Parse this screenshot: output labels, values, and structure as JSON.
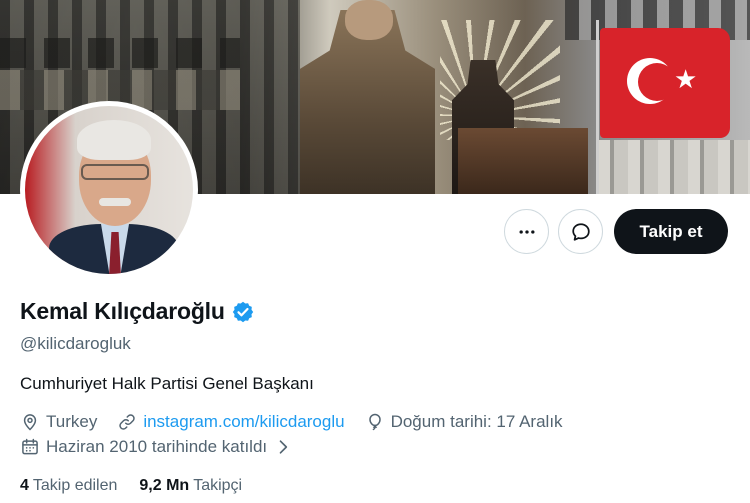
{
  "profile": {
    "name": "Kemal Kılıçdaroğlu",
    "handle": "@kilicdarogluk",
    "bio": "Cumhuriyet Halk Partisi Genel Başkanı",
    "verified": true
  },
  "meta": {
    "location": "Turkey",
    "link": "instagram.com/kilicdaroglu",
    "birthday": "Doğum tarihi: 17 Aralık",
    "joined": "Haziran 2010 tarihinde katıldı"
  },
  "stats": {
    "following_count": "4",
    "following_label": "Takip edilen",
    "followers_count": "9,2 Mn",
    "followers_label": "Takipçi"
  },
  "actions": {
    "follow_label": "Takip et"
  },
  "icons": {
    "more": "ellipsis-icon",
    "message": "message-bubble-icon",
    "verified": "verified-badge-icon",
    "location": "location-pin-icon",
    "link": "link-icon",
    "birthday": "balloon-icon",
    "joined": "calendar-icon",
    "joined_chevron": "chevron-right-icon"
  },
  "colors": {
    "accent": "#1d9bf0",
    "text": "#0f1419",
    "secondary": "#536471",
    "follow_bg": "#0f1419"
  }
}
